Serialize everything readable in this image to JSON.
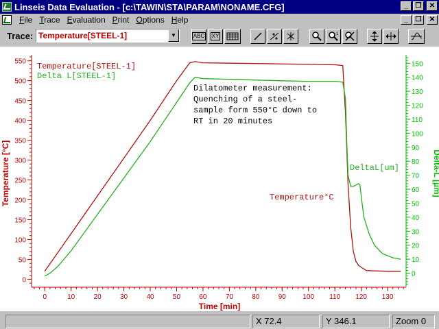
{
  "window": {
    "title": "Linseis Data Evaluation - [c:\\TAWIN\\STA\\PARAM\\NONAME.CFG]"
  },
  "menu": {
    "items": [
      "File",
      "Trace",
      "Evaluation",
      "Print",
      "Options",
      "Help"
    ]
  },
  "toolbar": {
    "trace_label": "Trace:",
    "trace_value": "Temperature[STEEL-1]",
    "buttons": [
      "ABC",
      "XY",
      "grid",
      "line",
      "point-marker",
      "cross-marker",
      "zoom-in",
      "zoom-reset",
      "zoom-cancel",
      "y-scale",
      "x-scale",
      "trace-settings"
    ]
  },
  "status": {
    "x": "X 72.4",
    "y": "Y 346.1",
    "zoom": "Zoom 0"
  },
  "colors": {
    "temperature": "#b01010",
    "delta": "#20b020",
    "axis_left": "#c00000",
    "axis_right": "#00c000"
  },
  "chart_data": {
    "type": "line",
    "xlabel": "Time  [min]",
    "ylabel_left": "Temperature  [°C]",
    "ylabel_right": "Delta-L  [µm]",
    "xlim": [
      -5,
      137
    ],
    "ylim_left": [
      -20,
      565
    ],
    "ylim_right": [
      -10,
      156
    ],
    "x_ticks": [
      0,
      10,
      20,
      30,
      40,
      50,
      60,
      70,
      80,
      90,
      100,
      110,
      120,
      130
    ],
    "y_left_ticks": [
      0,
      50,
      100,
      150,
      200,
      250,
      300,
      350,
      400,
      450,
      500,
      550
    ],
    "y_right_ticks": [
      0,
      10,
      20,
      30,
      40,
      50,
      60,
      70,
      80,
      90,
      100,
      110,
      120,
      130,
      140,
      150
    ],
    "legend": [
      "Temperature[STEEL-1]",
      "Delta L[STEEL-1]"
    ],
    "annotation": [
      "Dilatometer measurement:",
      "Quenching of a steel-",
      "sample form 550°C down to",
      "RT in 20 minutes"
    ],
    "label_delta": "DeltaL[um]",
    "label_temp": "Temperature°C",
    "series": [
      {
        "name": "Temperature[STEEL-1]",
        "axis": "left",
        "x": [
          0,
          10,
          20,
          30,
          40,
          50,
          55,
          57,
          60,
          70,
          80,
          90,
          100,
          110,
          113,
          114,
          115,
          116,
          117,
          118,
          119,
          120,
          122,
          125,
          130,
          135
        ],
        "y": [
          20,
          115,
          210,
          305,
          400,
          500,
          545,
          548,
          545,
          544,
          543,
          542,
          541,
          540,
          538,
          420,
          240,
          130,
          70,
          45,
          35,
          30,
          22,
          21,
          20,
          20
        ]
      },
      {
        "name": "Delta L[STEEL-1]",
        "axis": "right",
        "x": [
          0,
          2,
          5,
          10,
          20,
          30,
          40,
          50,
          55,
          57,
          60,
          70,
          80,
          90,
          100,
          110,
          113,
          114,
          114.5,
          115,
          116,
          117,
          118,
          119,
          119.5,
          120,
          121,
          123,
          125,
          128,
          132,
          135
        ],
        "y": [
          -2,
          0,
          5,
          16,
          42,
          68,
          94,
          122,
          136,
          140,
          139,
          138.5,
          138,
          137.5,
          137,
          137,
          136.5,
          125,
          95,
          70,
          62,
          62,
          63,
          64,
          63,
          55,
          40,
          28,
          20,
          14,
          11,
          10
        ]
      }
    ]
  }
}
